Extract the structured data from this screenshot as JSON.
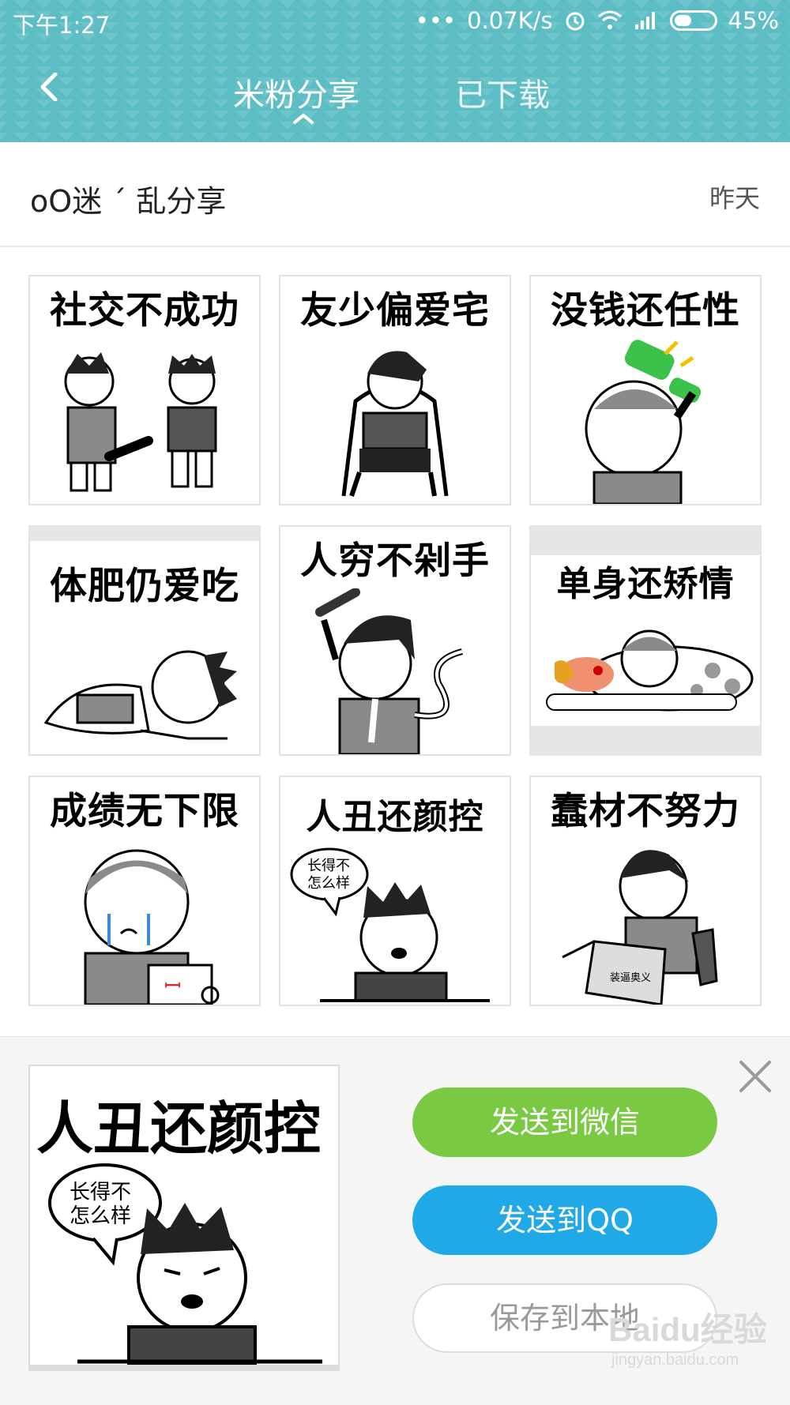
{
  "status_bar": {
    "time": "下午1:27",
    "network_speed": "0.07K/s",
    "battery_percent": "45%",
    "battery_level": 0.45,
    "icons": [
      "dots-icon",
      "alarm-icon",
      "wifi-icon",
      "signal-icon",
      "battery-icon"
    ]
  },
  "nav": {
    "back_icon": "back-arrow-icon",
    "tabs": [
      {
        "label": "米粉分享",
        "active": true
      },
      {
        "label": "已下载",
        "active": false
      }
    ]
  },
  "author": {
    "name": "oO迷  ´ 乱分享",
    "date": "昨天"
  },
  "stickers": [
    {
      "caption": "社交不成功"
    },
    {
      "caption": "友少偏爱宅"
    },
    {
      "caption": "没钱还任性"
    },
    {
      "caption": "体肥仍爱吃"
    },
    {
      "caption": "人穷不剁手"
    },
    {
      "caption": "单身还矫情"
    },
    {
      "caption": "成绩无下限"
    },
    {
      "caption": "人丑还颜控",
      "bubble": "长得不怎么样"
    },
    {
      "caption": "蠢材不努力",
      "book_text": "装逼奥义"
    }
  ],
  "panel": {
    "preview_caption": "人丑还颜控",
    "preview_bubble": "长得不怎么样",
    "close_icon": "close-icon",
    "buttons": {
      "wechat": "发送到微信",
      "qq": "发送到QQ",
      "save": "保存到本地"
    }
  },
  "watermark": {
    "brand": "Baidu经验",
    "url": "jingyan.baidu.com"
  },
  "colors": {
    "header": "#5dbdc5",
    "wechat": "#7ac943",
    "qq": "#21a8e6"
  }
}
